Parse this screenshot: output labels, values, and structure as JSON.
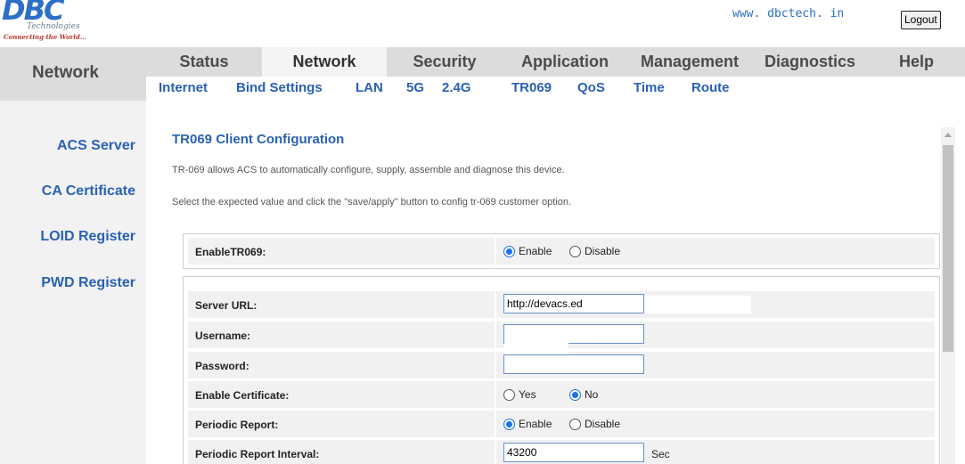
{
  "header": {
    "logo_text": "DBC",
    "logo_sub": "Technologies",
    "logo_tagline": "Connecting the World...",
    "site_url": "www. dbctech. in",
    "logout_label": "Logout",
    "brand_color": "#2a61b5"
  },
  "nav": {
    "section_title": "Network",
    "main_tabs": [
      {
        "label": "Status"
      },
      {
        "label": "Network"
      },
      {
        "label": "Security"
      },
      {
        "label": "Application"
      },
      {
        "label": "Management"
      },
      {
        "label": "Diagnostics"
      },
      {
        "label": "Help"
      }
    ],
    "active_main_tab": "Network",
    "sub_tabs": [
      {
        "label": "Internet"
      },
      {
        "label": "Bind Settings"
      },
      {
        "label": "LAN"
      },
      {
        "label": "5G"
      },
      {
        "label": "2.4G"
      },
      {
        "label": "TR069"
      },
      {
        "label": "QoS"
      },
      {
        "label": "Time"
      },
      {
        "label": "Route"
      }
    ]
  },
  "side_menu": {
    "items": [
      {
        "label": "ACS Server"
      },
      {
        "label": "CA Certificate"
      },
      {
        "label": "LOID Register"
      },
      {
        "label": "PWD Register"
      }
    ]
  },
  "content": {
    "title": "TR069 Client Configuration",
    "description_1": "TR-069 allows ACS to automatically configure, supply, assemble and diagnose this device.",
    "description_2": "Select the expected value and click the \"save/apply\" button to config tr-069 customer option.",
    "enable_tr069": {
      "label": "EnableTR069:",
      "options": [
        "Enable",
        "Disable"
      ],
      "selected": "Enable"
    },
    "server_url": {
      "label": "Server URL:",
      "value": "http://devacs.ed"
    },
    "username": {
      "label": "Username:",
      "value": ""
    },
    "password": {
      "label": "Password:",
      "value": ""
    },
    "enable_certificate": {
      "label": "Enable Certificate:",
      "options": [
        "Yes",
        "No"
      ],
      "selected": "No"
    },
    "periodic_report": {
      "label": "Periodic Report:",
      "options": [
        "Enable",
        "Disable"
      ],
      "selected": "Enable"
    },
    "periodic_interval": {
      "label": "Periodic Report Interval:",
      "value": "43200",
      "unit": "Sec"
    }
  }
}
